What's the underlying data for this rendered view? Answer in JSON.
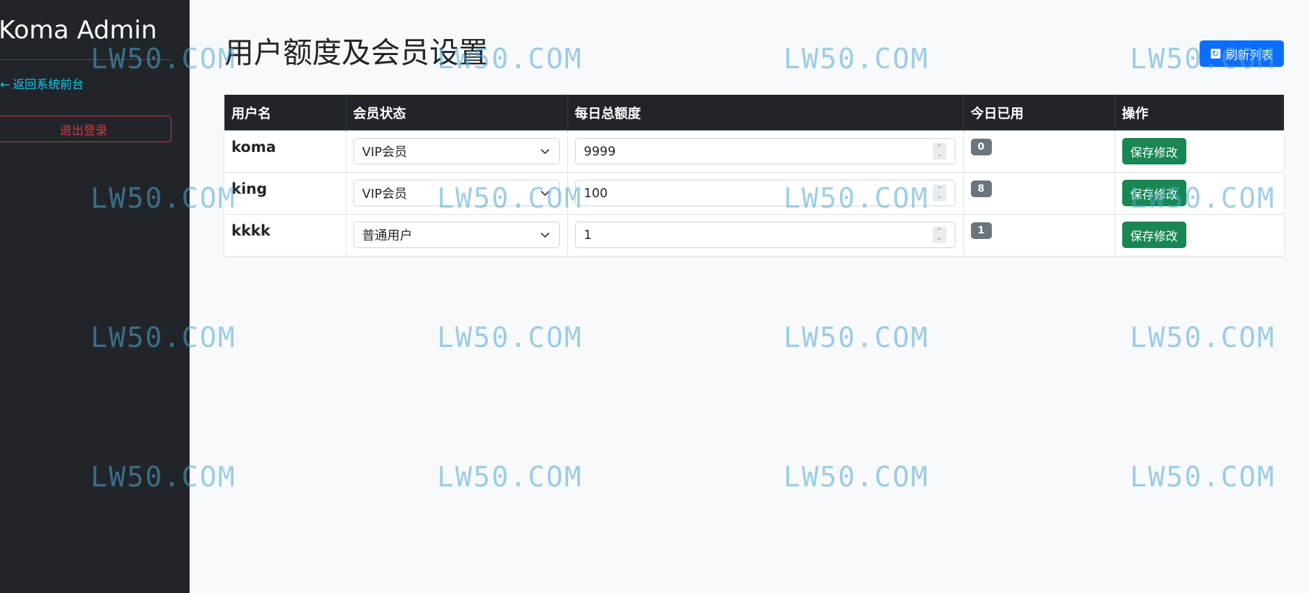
{
  "sidebar": {
    "brand": "Koma Admin",
    "back_link": "返回系统前台",
    "back_arrow": "←",
    "logout": "退出登录"
  },
  "header": {
    "title": "用户额度及会员设置",
    "refresh_label": "刷新列表",
    "refresh_icon": "refresh-icon"
  },
  "table": {
    "columns": [
      "用户名",
      "会员状态",
      "每日总额度",
      "今日已用",
      "操作"
    ],
    "rows": [
      {
        "username": "koma",
        "membership": "VIP会员",
        "daily_quota": "9999",
        "used_today": "0",
        "action": "保存修改"
      },
      {
        "username": "king",
        "membership": "VIP会员",
        "daily_quota": "100",
        "used_today": "8",
        "action": "保存修改"
      },
      {
        "username": "kkkk",
        "membership": "普通用户",
        "daily_quota": "1",
        "used_today": "1",
        "action": "保存修改"
      }
    ]
  },
  "watermark": "LW50.COM",
  "colors": {
    "sidebar_bg": "#212529",
    "primary": "#0d6efd",
    "success": "#198754",
    "danger": "#dc3545",
    "info": "#0dcaf0",
    "badge": "#6c757d"
  }
}
